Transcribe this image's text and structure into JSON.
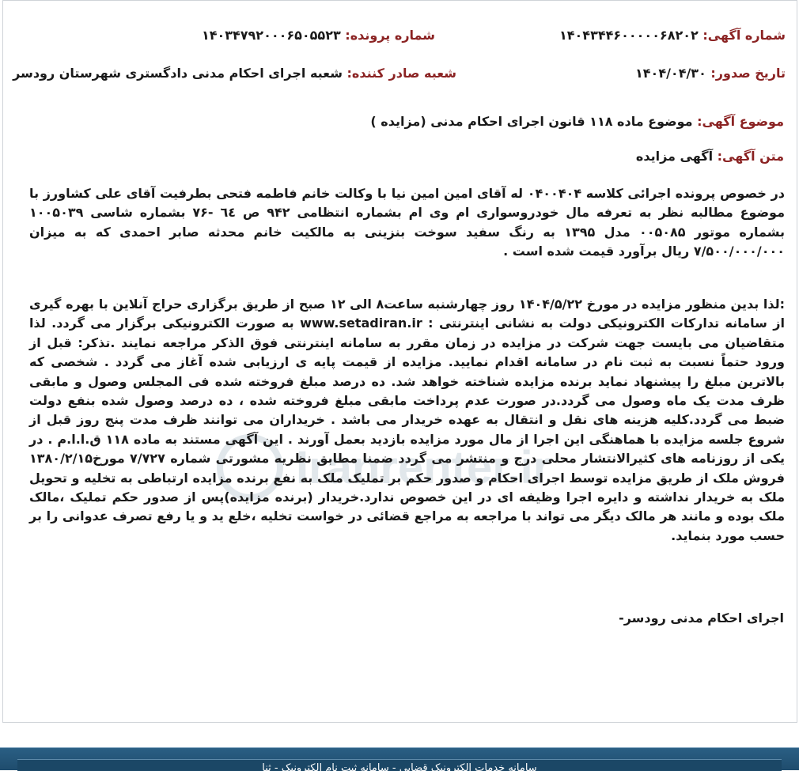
{
  "header": {
    "notice_number_label": "شماره آگهی:",
    "notice_number": "۱۴۰۴۳۴۴۶۰۰۰۰۰۶۸۲۰۲",
    "case_number_label": "شماره پرونده:",
    "case_number": "۱۴۰۳۴۷۹۲۰۰۰۶۵۰۵۵۲۳",
    "issue_date_label": "تاریخ صدور:",
    "issue_date": "۱۴۰۴/۰۴/۳۰",
    "issuer_label": "شعبه صادر کننده:",
    "issuer": "شعبه اجرای احکام مدنی دادگستری شهرستان رودسر",
    "subject_label": "موضوع آگهی:",
    "subject": "موضوع ماده ۱۱۸ قانون اجرای احکام مدنی (مزایده )",
    "text_label": "متن آگهی:",
    "text_title": "آگهی مزایده"
  },
  "body": {
    "paragraph_1": "در خصوص پرونده اجرائی کلاسه ۰۴۰۰۴۰۴ له آقای امین امین نیا با وکالت خانم فاطمه فتحی بطرفیت آقای علی کشاورز با موضوع مطالبه نظر به تعرفه مال خودروسواری ام وی ام بشماره انتظامی ۹۴۲ ص ٦٤ -۷۶ بشماره شاسی ۱۰۰۵۰۳۹ بشماره موتور ۰۰۵۰۸۵ مدل ۱۳۹۵ به رنگ سفید سوخت بنزینی به مالکیت خانم محدثه صابر احمدی که به میزان ۷/۵۰۰/۰۰۰/۰۰۰ ریال برآورد قیمت شده است .",
    "paragraph_2": ":لذا بدین منظور مزایده در مورخ ۱۴۰۴/۵/۲۲ روز چهارشنبه ساعت۸ الی ۱۲ صبح از طریق برگزاری حراج آنلاین با بهره گیری از سامانه تدارکات الکترونیکی دولت به نشانی اینترنتی : www.setadiran.ir به صورت الکترونیکی برگزار می گردد. لذا متقاضیان می بایست جهت شرکت در مزایده در زمان مقرر به سامانه اینترنتی فوق الذکر مراجعه نمایند .تذکر: قبل از ورود حتماً نسبت به ثبت نام در سامانه اقدام نمایید. مزایده از قیمت پایه ی ارزیابی شده آغاز می گردد . شخصی که بالاترین مبلغ را پیشنهاد نماید برنده مزایده شناخته خواهد شد. ده درصد مبلغ فروخته شده فی المجلس وصول و مابقی ظرف مدت یک ماه وصول می گردد.در صورت عدم پرداخت مابقی مبلغ فروخته شده ، ده درصد وصول شده بنفع دولت ضبط می گردد.کلیه هزینه های نقل و انتقال به عهده خریدار می باشد . خریداران می توانند ظرف مدت پنج روز قبل از شروع جلسه مزایده با هماهنگی این اجرا از مال مورد مزایده بازدید بعمل آورند . این آگهی مستند به ماده ۱۱۸ ق.ا.ا.م . در یکی از روزنامه های کثیرالانتشار محلی درج و منتشر می گردد ضمنا مطابق نظریه مشورتی شماره ۷/۷۲۷ مورخ۱۳۸۰/۲/۱۵ فروش ملک از طریق مزایده توسط اجرای احکام و صدور حکم بر تملیک ملک به نفع برنده مزایده ارتباطی به تخلیه و تحویل ملک به خریدار نداشته و دایره اجرا وظیفه ای در این خصوص ندارد.خریدار (برنده مزایده)پس از صدور حکم تملیک ،مالک ملک بوده و مانند هر مالک دیگر می تواند با مراجعه به مراجع قضائی در خواست تخلیه ،خلع ید و یا رفع تصرف عدوانی را بر حسب مورد بنماید.",
    "signature": "اجرای احکام مدنی رودسر-"
  },
  "watermark": "Iranrenter.ir",
  "footer": {
    "text": "سامانه خدمات الکترونیک قضایی - سامانه ثبت نام الکترونیک - ثنا"
  },
  "colors": {
    "label": "#8b2323",
    "text": "#1a1a1a",
    "footer_bg": "#1f4c6d"
  }
}
